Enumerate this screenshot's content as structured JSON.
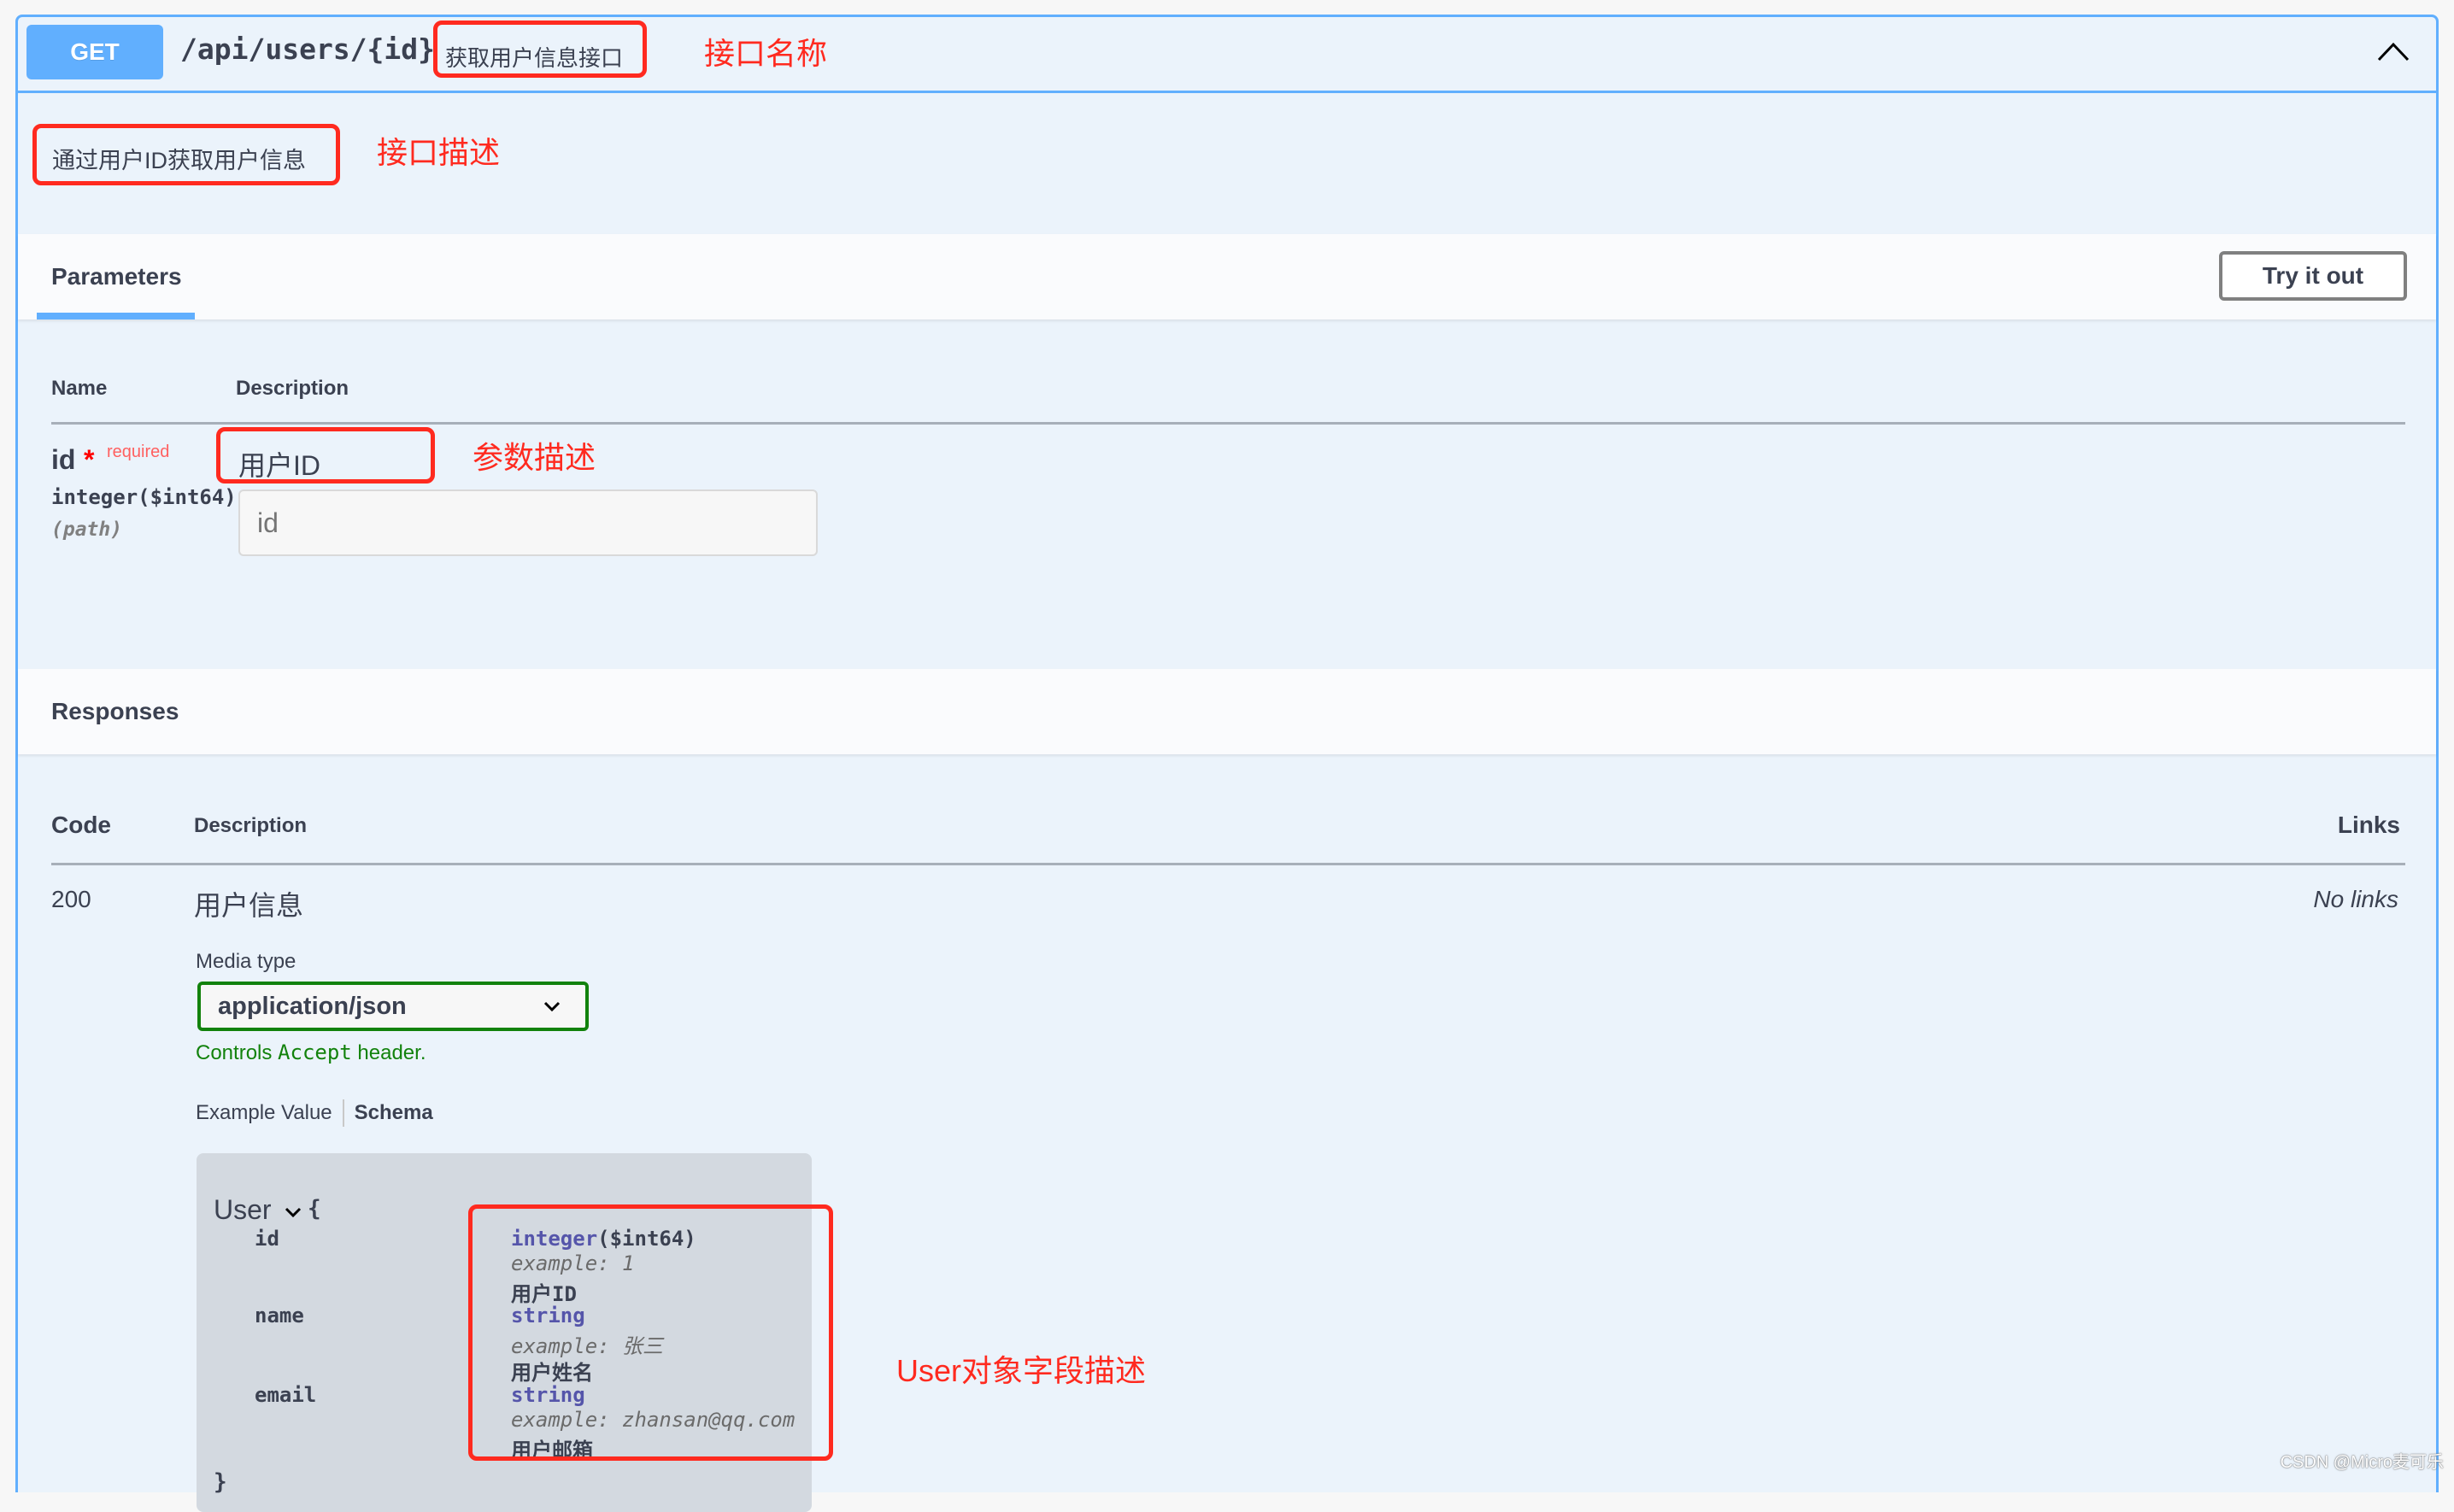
{
  "operation": {
    "method": "GET",
    "path": "/api/users/{id}",
    "summary": "获取用户信息接口",
    "description": "通过用户ID获取用户信息",
    "collapse_icon": "chevron-up-icon",
    "colors": {
      "get_blue": "#61affe",
      "annotation_red": "#ff2a1f",
      "accept_green": "#12820c"
    }
  },
  "annotations": {
    "name_label": "接口名称",
    "desc_label": "接口描述",
    "param_label": "参数描述",
    "schema_label": "User对象字段描述"
  },
  "parameters": {
    "tab_label": "Parameters",
    "try_button": "Try it out",
    "columns": {
      "name": "Name",
      "description": "Description"
    },
    "items": [
      {
        "name": "id",
        "required_star": "*",
        "required_label": "required",
        "type": "integer($int64)",
        "location": "(path)",
        "description": "用户ID",
        "input_placeholder": "id"
      }
    ]
  },
  "responses": {
    "tab_label": "Responses",
    "columns": {
      "code": "Code",
      "description": "Description",
      "links": "Links"
    },
    "items": [
      {
        "code": "200",
        "description": "用户信息",
        "links": "No links",
        "media_type_label": "Media type",
        "media_type": "application/json",
        "accept_note_prefix": "Controls ",
        "accept_note_code": "Accept",
        "accept_note_suffix": " header.",
        "example_tab": "Example Value",
        "schema_tab": "Schema",
        "schema": {
          "model": "User",
          "open_brace": "{",
          "close_brace": "}",
          "fields": [
            {
              "name": "id",
              "type": "integer",
              "format": "($int64)",
              "example": "example: 1",
              "description": "用户ID"
            },
            {
              "name": "name",
              "type": "string",
              "format": "",
              "example": "example: 张三",
              "description": "用户姓名"
            },
            {
              "name": "email",
              "type": "string",
              "format": "",
              "example": "example: zhansan@qq.com",
              "description": "用户邮箱"
            }
          ]
        }
      }
    ]
  },
  "watermark": "CSDN @Micro麦可乐"
}
